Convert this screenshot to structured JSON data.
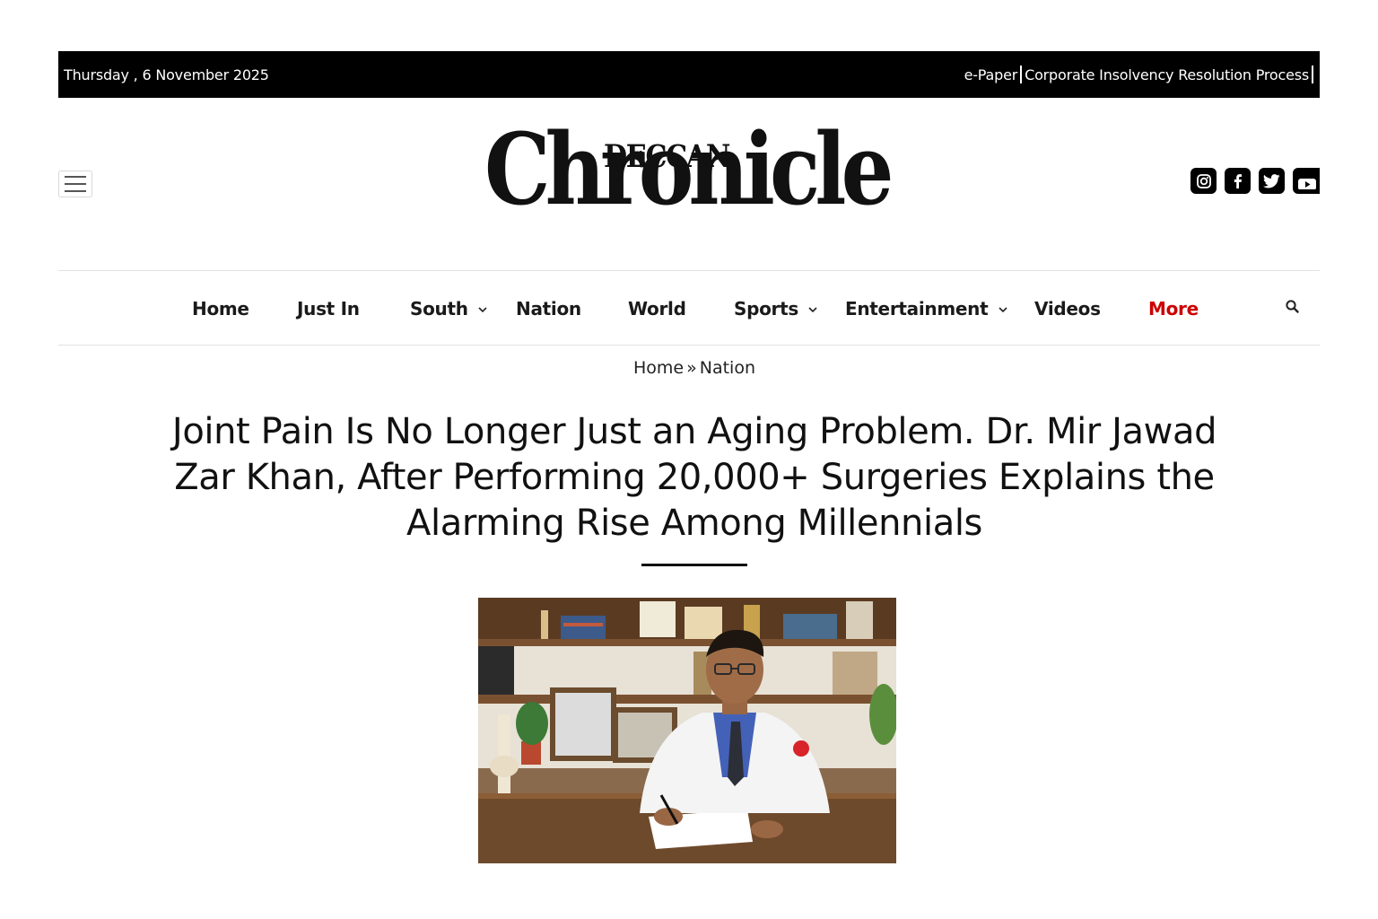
{
  "topbar": {
    "date": "Thursday , 6 November 2025",
    "links": [
      "e-Paper",
      "Corporate Insolvency Resolution Process"
    ]
  },
  "header": {
    "logo_small": "DECCAN",
    "logo_big": "Chronicle",
    "social_icons": [
      "instagram-icon",
      "facebook-icon",
      "twitter-icon",
      "youtube-icon"
    ]
  },
  "nav": {
    "items": [
      {
        "label": "Home",
        "dropdown": false
      },
      {
        "label": "Just In",
        "dropdown": false
      },
      {
        "label": "South",
        "dropdown": true
      },
      {
        "label": "Nation",
        "dropdown": false
      },
      {
        "label": "World",
        "dropdown": false
      },
      {
        "label": "Sports",
        "dropdown": true
      },
      {
        "label": "Entertainment",
        "dropdown": true
      },
      {
        "label": "Videos",
        "dropdown": false
      },
      {
        "label": "More",
        "dropdown": false
      }
    ],
    "accent_color": "#cc0000"
  },
  "breadcrumb": {
    "home": "Home",
    "separator": "»",
    "current": "Nation"
  },
  "article": {
    "headline": "Joint Pain Is No Longer Just an Aging Problem. Dr. Mir Jawad Zar Khan, After Performing 20,000+ Surgeries Explains the Alarming Rise Among Millennials"
  }
}
